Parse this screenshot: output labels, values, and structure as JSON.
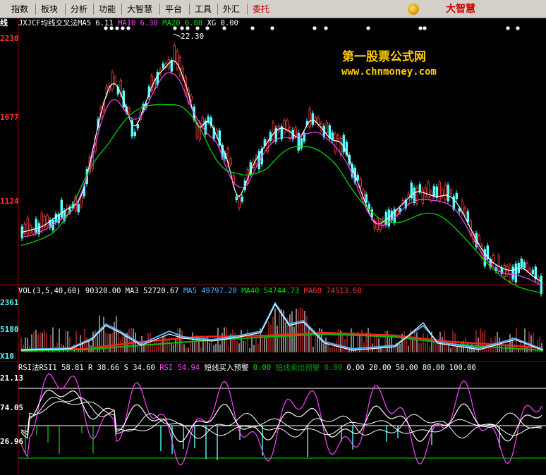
{
  "menu": {
    "items": [
      {
        "label": "指数"
      },
      {
        "label": "板块"
      },
      {
        "label": "分析"
      },
      {
        "label": "功能"
      },
      {
        "label": "大智慧"
      },
      {
        "label": "平台"
      },
      {
        "label": "工具"
      },
      {
        "label": "外汇"
      },
      {
        "label": "委托"
      }
    ],
    "brand": "大智慧"
  },
  "main_chart": {
    "left_edge_label": "线",
    "indicator": {
      "name": "JXJCF均线交叉法",
      "ma5_label": "MA5",
      "ma5_value": "6.11",
      "ma10_label": "MA10",
      "ma10_value": "6.30",
      "ma20_label": "MA20",
      "ma20_value": "6.88",
      "xg_label": "XG",
      "xg_value": "0.00"
    },
    "y_labels": [
      "2230",
      "1677",
      "1124"
    ],
    "peak_label": "22.30",
    "watermark_title": "第一股票公式网",
    "watermark_url": "www.chnmoney.com"
  },
  "vol_chart": {
    "name": "VOL(3,5,40,60)",
    "value": "90320.00",
    "ma3": "MA3 52720.67",
    "ma5": "MA5 49797.20",
    "ma40": "MA40 54744.73",
    "ma60": "MA60 74513.68",
    "y_labels": [
      "2361",
      "5180",
      "X10"
    ]
  },
  "rsi_chart": {
    "name": "RSI法RSI1",
    "rsi1": "58.81",
    "r": "R 38.66",
    "s": "S 34.60",
    "rsi": "RSI 54.94",
    "buy_label": "短线买入预警",
    "buy_value": "0.00",
    "sell_label": "短线卖出预警",
    "sell_value": "0.00",
    "levels": [
      "0.00",
      "20.00",
      "50.00",
      "80.00",
      "100.00"
    ],
    "y_labels": [
      "21.13",
      "74.05",
      "26.96"
    ]
  },
  "colors": {
    "up": "#ff3c3c",
    "down": "#54ffff",
    "ma5": "#ffffff",
    "ma10": "#ff40ff",
    "ma20": "#00e000",
    "axis": "#ff3030",
    "vol_ma40": "#00c000",
    "vol_ma60": "#ff2020",
    "vol_ma3": "#4fb0ff"
  }
}
